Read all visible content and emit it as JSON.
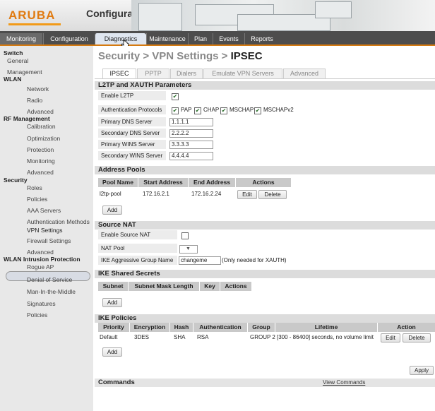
{
  "header": {
    "brand": "ARUBA",
    "app_title": "Configuration"
  },
  "nav": {
    "items": [
      "Monitoring",
      "Configuration",
      "Diagnostics",
      "Maintenance",
      "Plan",
      "Events",
      "Reports"
    ]
  },
  "sidebar": {
    "switch": {
      "heading": "Switch",
      "items": [
        "General",
        "Management"
      ]
    },
    "wlan": {
      "heading": "WLAN",
      "items": [
        "Network",
        "Radio",
        "Advanced"
      ]
    },
    "rf": {
      "heading": "RF Management",
      "items": [
        "Calibration",
        "Optimization",
        "Protection",
        "Monitoring",
        "Advanced"
      ]
    },
    "security": {
      "heading": "Security",
      "items": [
        "Roles",
        "Policies",
        "AAA Servers",
        "Authentication Methods",
        "VPN Settings",
        "Firewall Settings",
        "Advanced"
      ]
    },
    "wip": {
      "heading": "WLAN Intrusion Protection",
      "items": [
        "Rogue AP",
        "Denial of Service",
        "Man-In-the-Middle",
        "Signatures",
        "Policies"
      ]
    }
  },
  "page": {
    "title_prefix": "Security > VPN Settings > ",
    "title_current": "IPSEC"
  },
  "tabs": [
    "IPSEC",
    "PPTP",
    "Dialers",
    "Emulate VPN Servers",
    "Advanced"
  ],
  "l2tp": {
    "heading": "L2TP and XAUTH Parameters",
    "enable_label": "Enable L2TP",
    "enable_checked": true,
    "auth_label": "Authentication Protocols",
    "protocols": [
      {
        "name": "PAP",
        "checked": true
      },
      {
        "name": "CHAP",
        "checked": true
      },
      {
        "name": "MSCHAP",
        "checked": true
      },
      {
        "name": "MSCHAPv2",
        "checked": true
      }
    ],
    "primary_dns_label": "Primary DNS Server",
    "primary_dns": "1.1.1.1",
    "secondary_dns_label": "Secondary DNS Server",
    "secondary_dns": "2.2.2.2",
    "primary_wins_label": "Primary WINS Server",
    "primary_wins": "3.3.3.3",
    "secondary_wins_label": "Secondary WINS Server",
    "secondary_wins": "4.4.4.4"
  },
  "address_pools": {
    "heading": "Address Pools",
    "columns": [
      "Pool Name",
      "Start Address",
      "End Address",
      "Actions"
    ],
    "rows": [
      {
        "name": "l2tp-pool",
        "start": "172.16.2.1",
        "end": "172.16.2.24"
      }
    ],
    "edit_label": "Edit",
    "delete_label": "Delete",
    "add_label": "Add"
  },
  "source_nat": {
    "heading": "Source NAT",
    "enable_label": "Enable Source NAT",
    "enable_checked": false,
    "pool_label": "NAT Pool",
    "pool_value": "",
    "ike_group_label": "IKE Aggressive Group Name",
    "ike_group_value": "changeme",
    "ike_group_note": "(Only needed for XAUTH)"
  },
  "ike_secrets": {
    "heading": "IKE Shared Secrets",
    "columns": [
      "Subnet",
      "Subnet Mask Length",
      "Key",
      "Actions"
    ],
    "add_label": "Add"
  },
  "ike_policies": {
    "heading": "IKE Policies",
    "columns": [
      "Priority",
      "Encryption",
      "Hash",
      "Authentication",
      "Group",
      "Lifetime",
      "Action"
    ],
    "rows": [
      {
        "priority": "Default",
        "encryption": "3DES",
        "hash": "SHA",
        "auth": "RSA",
        "group": "GROUP 2",
        "lifetime": "[300 - 86400] seconds, no volume limit"
      }
    ],
    "edit_label": "Edit",
    "delete_label": "Delete",
    "add_label": "Add"
  },
  "apply_label": "Apply",
  "commands": {
    "heading": "Commands",
    "link": "View Commands"
  },
  "colors": {
    "accent": "#e07a10",
    "nav_bg": "#4d4d4d",
    "sidebar_bg": "#e8e8e8",
    "section_bg": "#dcdcdc"
  },
  "icons": [
    "hand-pointer-icon",
    "check-icon",
    "dropdown-arrow-icon"
  ]
}
